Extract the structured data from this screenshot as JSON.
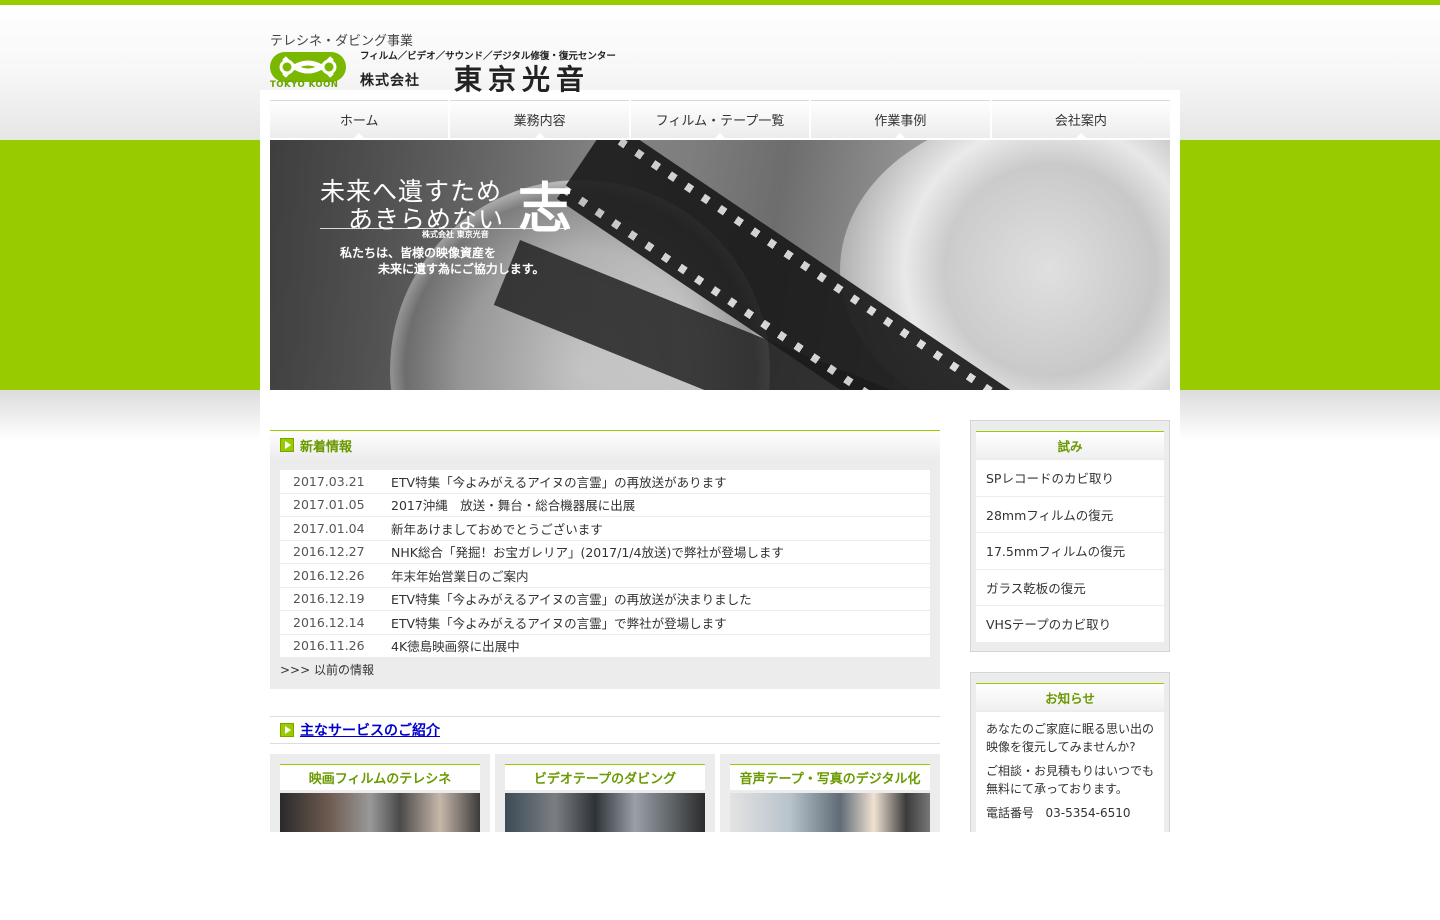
{
  "header": {
    "tagline": "テレシネ・ダビング事業",
    "logo_en": "TOKYO KOON",
    "company_sub": "フィルム／ビデオ／サウンド／デジタル修復・復元センター",
    "company_prefix": "株式会社",
    "company_name": "東京光音"
  },
  "nav": [
    {
      "label": "ホーム"
    },
    {
      "label": "業務内容"
    },
    {
      "label": "フィルム・テープ一覧"
    },
    {
      "label": "作業事例"
    },
    {
      "label": "会社案内"
    }
  ],
  "hero": {
    "line1": "未来へ遺すため",
    "line2": "あきらめない",
    "kanji": "志",
    "mini": "株式会社 東京光音",
    "sub1": "私たちは、皆様の映像資産を",
    "sub2": "未来に遺す為にご協力します。"
  },
  "news": {
    "title": "新着情報",
    "items": [
      {
        "date": "2017.03.21",
        "title": "ETV特集「今よみがえるアイヌの言霊」の再放送があります"
      },
      {
        "date": "2017.01.05",
        "title": "2017沖縄　放送・舞台・総合機器展に出展"
      },
      {
        "date": "2017.01.04",
        "title": "新年あけましておめでとうございます"
      },
      {
        "date": "2016.12.27",
        "title": "NHK総合「発掘！お宝ガレリア」(2017/1/4放送)で弊社が登場します"
      },
      {
        "date": "2016.12.26",
        "title": "年末年始営業日のご案内"
      },
      {
        "date": "2016.12.19",
        "title": "ETV特集「今よみがえるアイヌの言霊」の再放送が決まりました"
      },
      {
        "date": "2016.12.14",
        "title": "ETV特集「今よみがえるアイヌの言霊」で弊社が登場します"
      },
      {
        "date": "2016.11.26",
        "title": "4K徳島映画祭に出展中"
      }
    ],
    "more": ">>> 以前の情報"
  },
  "services": {
    "title": "主なサービスのご紹介",
    "cards": [
      {
        "title": "映画フィルムのテレシネ"
      },
      {
        "title": "ビデオテープのダビング"
      },
      {
        "title": "音声テープ・写真のデジタル化"
      }
    ]
  },
  "sidebar": {
    "trial": {
      "title": "試み",
      "items": [
        {
          "label": "SPレコードのカビ取り"
        },
        {
          "label": "28mmフィルムの復元"
        },
        {
          "label": "17.5mmフィルムの復元"
        },
        {
          "label": "ガラス乾板の復元"
        },
        {
          "label": "VHSテープのカビ取り"
        }
      ]
    },
    "notice": {
      "title": "お知らせ",
      "p1": "あなたのご家庭に眠る思い出の映像を復元してみませんか?",
      "p2": "ご相談・お見積もりはいつでも無料にて承っております。",
      "phone_label": "電話番号",
      "phone": "03-5354-6510"
    }
  },
  "colors": {
    "accent": "#99cc00",
    "accent_text": "#6a9a00",
    "link": "#0000cc"
  }
}
